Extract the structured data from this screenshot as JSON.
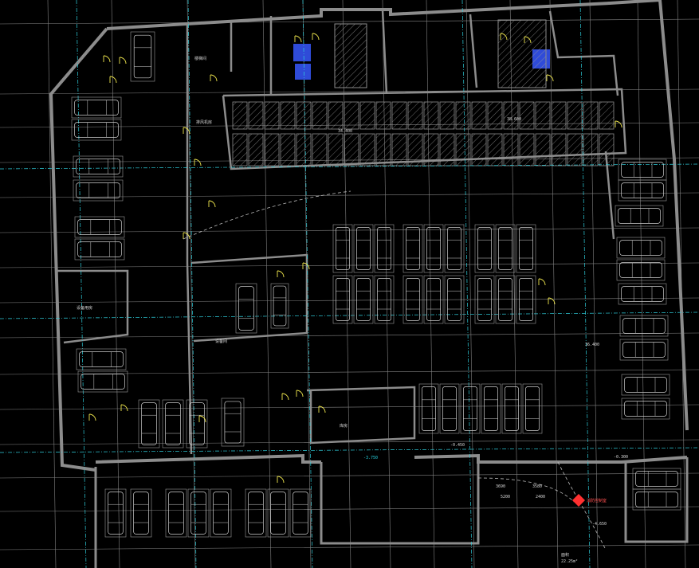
{
  "drawing": {
    "type": "basement parking floor plan (CAD)",
    "background": "#000000",
    "colors": {
      "wall": "#8c8c8c",
      "grid": "#9a9a9a",
      "axis": "#2fd0de",
      "car": "#cfcfcf",
      "hatch": "#b0b0b0",
      "stair": "#4a6cff",
      "door": "#f2e94e",
      "ramp": "#d8d8d8",
      "marker": "#ff3030"
    },
    "labels": {
      "dim_a": "34.400",
      "dim_b": "38.600",
      "dim_c": "-3.750",
      "dim_d": "-0.450",
      "dim_e": "36.400",
      "dim_f": "3690",
      "dim_g": "3580",
      "dim_h": "5200",
      "dim_i": "2400",
      "dim_j": "-4.650",
      "dim_k": "-0.300",
      "area": "22.25m²",
      "area_prefix": "面积",
      "fire_marker": "消防控制室",
      "note_1": "设备用房",
      "note_2": "库房",
      "note_3": "设备间",
      "note_4": "排风机房",
      "note_5": "楼梯间"
    }
  }
}
